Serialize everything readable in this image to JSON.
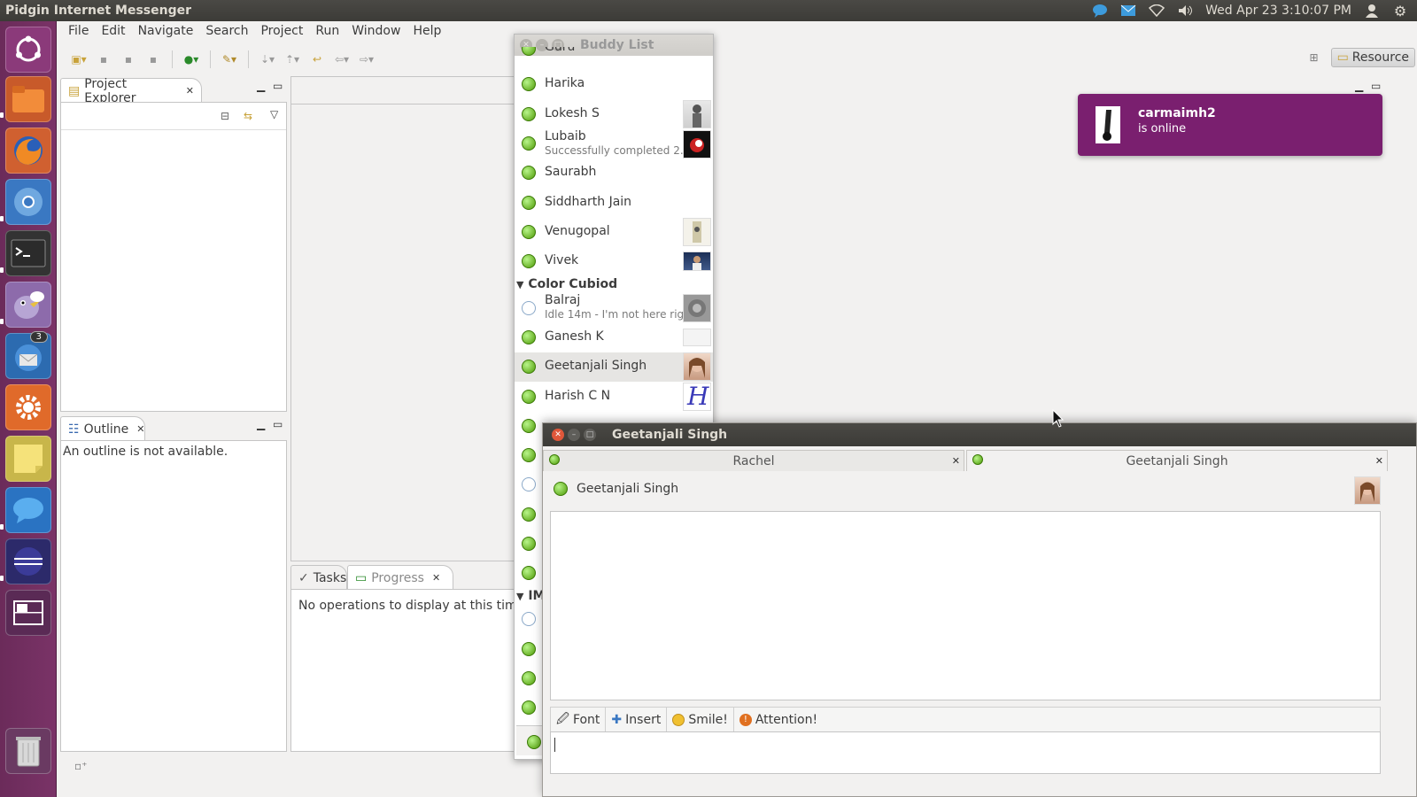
{
  "top_panel": {
    "app_title": "Pidgin Internet Messenger",
    "datetime": "Wed Apr 23  3:10:07 PM",
    "icons": [
      "pidgin-indicator-icon",
      "mail-icon",
      "wifi-icon",
      "volume-icon",
      "user-icon",
      "settings-gear-icon"
    ]
  },
  "launcher": {
    "items": [
      "ubuntu-dash",
      "files",
      "firefox",
      "chromium",
      "terminal",
      "pidgin",
      "thunderbird",
      "system-settings",
      "sticky-notes",
      "empathy",
      "eclipse",
      "workspace-switcher",
      "trash"
    ],
    "thunderbird_badge": "3"
  },
  "eclipse": {
    "menu": [
      "File",
      "Edit",
      "Navigate",
      "Search",
      "Project",
      "Run",
      "Window",
      "Help"
    ],
    "perspective_label": "Resource",
    "project_explorer_title": "Project Explorer",
    "outline_title": "Outline",
    "outline_message": "An outline is not available.",
    "tasks_title": "Tasks",
    "progress_title": "Progress",
    "progress_message": "No operations to display at this time."
  },
  "buddy_list": {
    "title": "Buddy List",
    "partial_top": "Guru",
    "buddies_1": [
      {
        "name": "Harika",
        "status": "online"
      },
      {
        "name": "Lokesh S",
        "status": "online"
      },
      {
        "name": "Lubaib",
        "sub": "Successfully completed 2...",
        "status": "online"
      },
      {
        "name": "Saurabh",
        "status": "online"
      },
      {
        "name": "Siddharth Jain",
        "status": "online"
      },
      {
        "name": "Venugopal",
        "status": "online"
      },
      {
        "name": "Vivek",
        "status": "online"
      }
    ],
    "group_2": "Color Cubiod",
    "buddies_2": [
      {
        "name": "Balraj",
        "sub": "Idle 14m - I'm not here rig...",
        "status": "idle"
      },
      {
        "name": "Ganesh K",
        "status": "online"
      },
      {
        "name": "Geetanjali Singh",
        "status": "online",
        "selected": true
      },
      {
        "name": "Harish C N",
        "status": "online"
      }
    ],
    "group_3_partial": "IM"
  },
  "notification": {
    "name": "carmaimh2",
    "message": "is online"
  },
  "chat": {
    "title": "Geetanjali Singh",
    "tabs": [
      {
        "label": "Rachel",
        "active": false
      },
      {
        "label": "Geetanjali Singh",
        "active": true
      }
    ],
    "buddy_name": "Geetanjali Singh",
    "toolbar": {
      "font": "Font",
      "insert": "Insert",
      "smile": "Smile!",
      "attention": "Attention!"
    },
    "input_value": ""
  },
  "colors": {
    "launcher_bg": "#7a3367",
    "notification_bg": "#7a1f6f",
    "online_green": "#4e9a06",
    "panel_dark": "#3c3b37"
  }
}
